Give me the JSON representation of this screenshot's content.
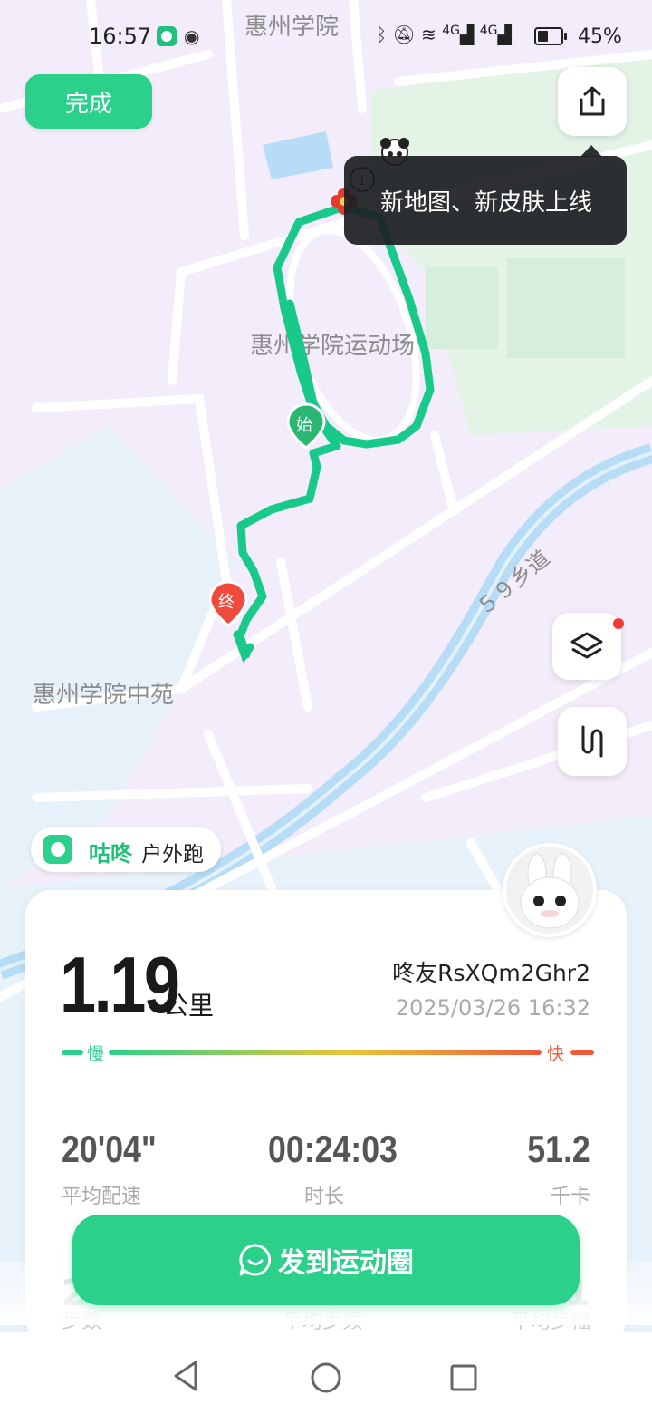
{
  "status_bar": {
    "time": "16:57",
    "icons": [
      "app-notification-icon",
      "wechat-icon",
      "bluetooth-icon",
      "mute-icon",
      "wifi-icon",
      "signal-4g-icon",
      "signal-4g-icon",
      "battery-icon"
    ],
    "network_1": "4G",
    "network_2": "4G",
    "battery_pct": "45%",
    "battery_level": 0.45
  },
  "toolbar": {
    "done_label": "完成"
  },
  "map": {
    "labels": {
      "campus_top": "惠州学院",
      "stadium": "惠州学院运动场",
      "zhongyuan": "惠州学院中苑",
      "road": "５９乡道"
    },
    "start_marker": "始",
    "end_marker": "终"
  },
  "tooltip": {
    "text": "新地图、新皮肤上线"
  },
  "brand": {
    "name": "咕咚",
    "activity": "户外跑"
  },
  "summary": {
    "distance": "1.19",
    "distance_unit": "公里",
    "user": "咚友RsXQm2Ghr2",
    "datetime": "2025/03/26 16:32",
    "pace_slow": "慢",
    "pace_fast": "快",
    "colors": {
      "slow": "#2bd08a",
      "mid": "#e9c53a",
      "fast": "#f05a3a"
    }
  },
  "metrics": [
    {
      "value": "20'04\"",
      "label": "平均配速"
    },
    {
      "value": "00:24:03",
      "label": "时长"
    },
    {
      "value": "51.2",
      "label": "千卡"
    }
  ],
  "partial_metrics": {
    "left": "2",
    "left_label": "步数",
    "mid_label": "平均步频",
    "right": "1",
    "right_label": "平均步幅"
  },
  "post_button": {
    "label": "发到运动圈"
  },
  "nav": {
    "icons": [
      "back-icon",
      "home-icon",
      "recents-icon"
    ]
  }
}
